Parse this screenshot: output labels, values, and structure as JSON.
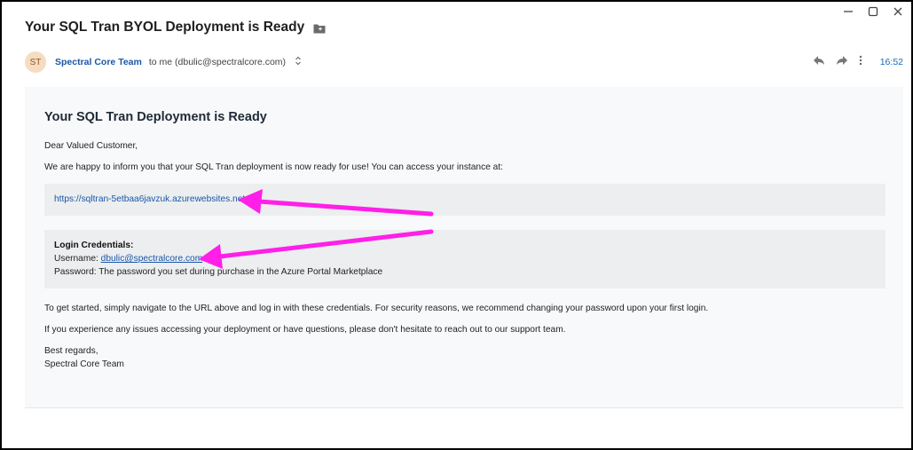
{
  "window": {
    "minimize_glyph": "—",
    "maximize_glyph": "☐",
    "close_glyph": "✕"
  },
  "subject": "Your SQL Tran BYOL Deployment is Ready",
  "sender": {
    "avatar_initials": "ST",
    "name": "Spectral Core Team",
    "recipient": "to me (dbulic@spectralcore.com)",
    "time": "16:52"
  },
  "icons": {
    "folder": "folder-icon",
    "expand": "chevron-up-down-icon",
    "reply": "reply-icon",
    "forward": "forward-icon",
    "more": "more-vertical-icon"
  },
  "email": {
    "heading": "Your SQL Tran Deployment is Ready",
    "greeting": "Dear Valued Customer,",
    "intro": "We are happy to inform you that your SQL Tran deployment is now ready for use! You can access your instance at:",
    "url": "https://sqltran-5etbaa6javzuk.azurewebsites.net",
    "credentials": {
      "title": "Login Credentials:",
      "username_label": "Username:",
      "username": "dbulic@spectralcore.com",
      "password_line": "Password: The password you set during purchase in the Azure Portal Marketplace"
    },
    "getting_started": "To get started, simply navigate to the URL above and log in with these credentials. For security reasons, we recommend changing your password upon your first login.",
    "support": "If you experience any issues accessing your deployment or have questions, please don't hesitate to reach out to our support team.",
    "closing": "Best regards,",
    "signature": "Spectral Core Team"
  },
  "colors": {
    "annotation_arrow": "#ff1fe8",
    "link": "#1a56a8",
    "sender": "#1a56a8"
  }
}
